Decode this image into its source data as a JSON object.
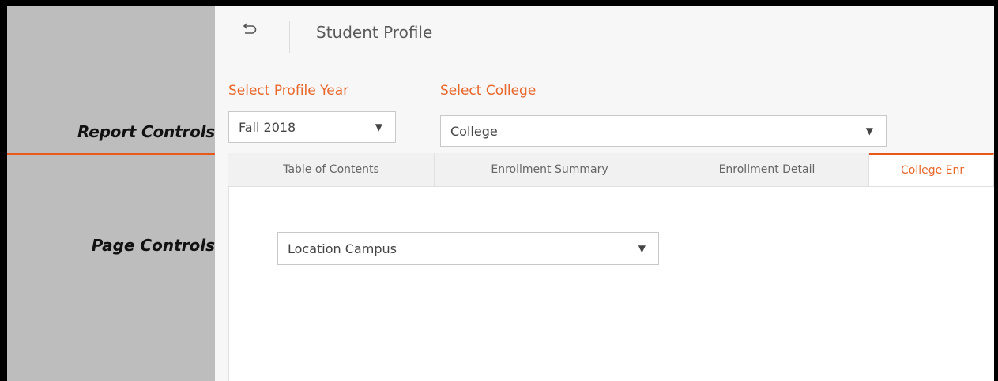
{
  "sidebar": {
    "report_controls_label": "Report Controls",
    "page_controls_label": "Page Controls"
  },
  "header": {
    "title": "Student Profile",
    "back_icon": "back-arrow-icon"
  },
  "filters": {
    "profile_year": {
      "label": "Select Profile Year",
      "value": "Fall 2018"
    },
    "college": {
      "label": "Select College",
      "value": "College"
    }
  },
  "tabs": [
    {
      "label": "Table of Contents",
      "active": false
    },
    {
      "label": "Enrollment Summary",
      "active": false
    },
    {
      "label": "Enrollment Detail",
      "active": false
    },
    {
      "label": "College Enr",
      "active": true
    }
  ],
  "page_controls": {
    "location": {
      "value": "Location Campus"
    }
  },
  "colors": {
    "accent": "#e8591a",
    "sidebar_bg": "#bdbdbd",
    "label_orange": "#e8672b"
  }
}
